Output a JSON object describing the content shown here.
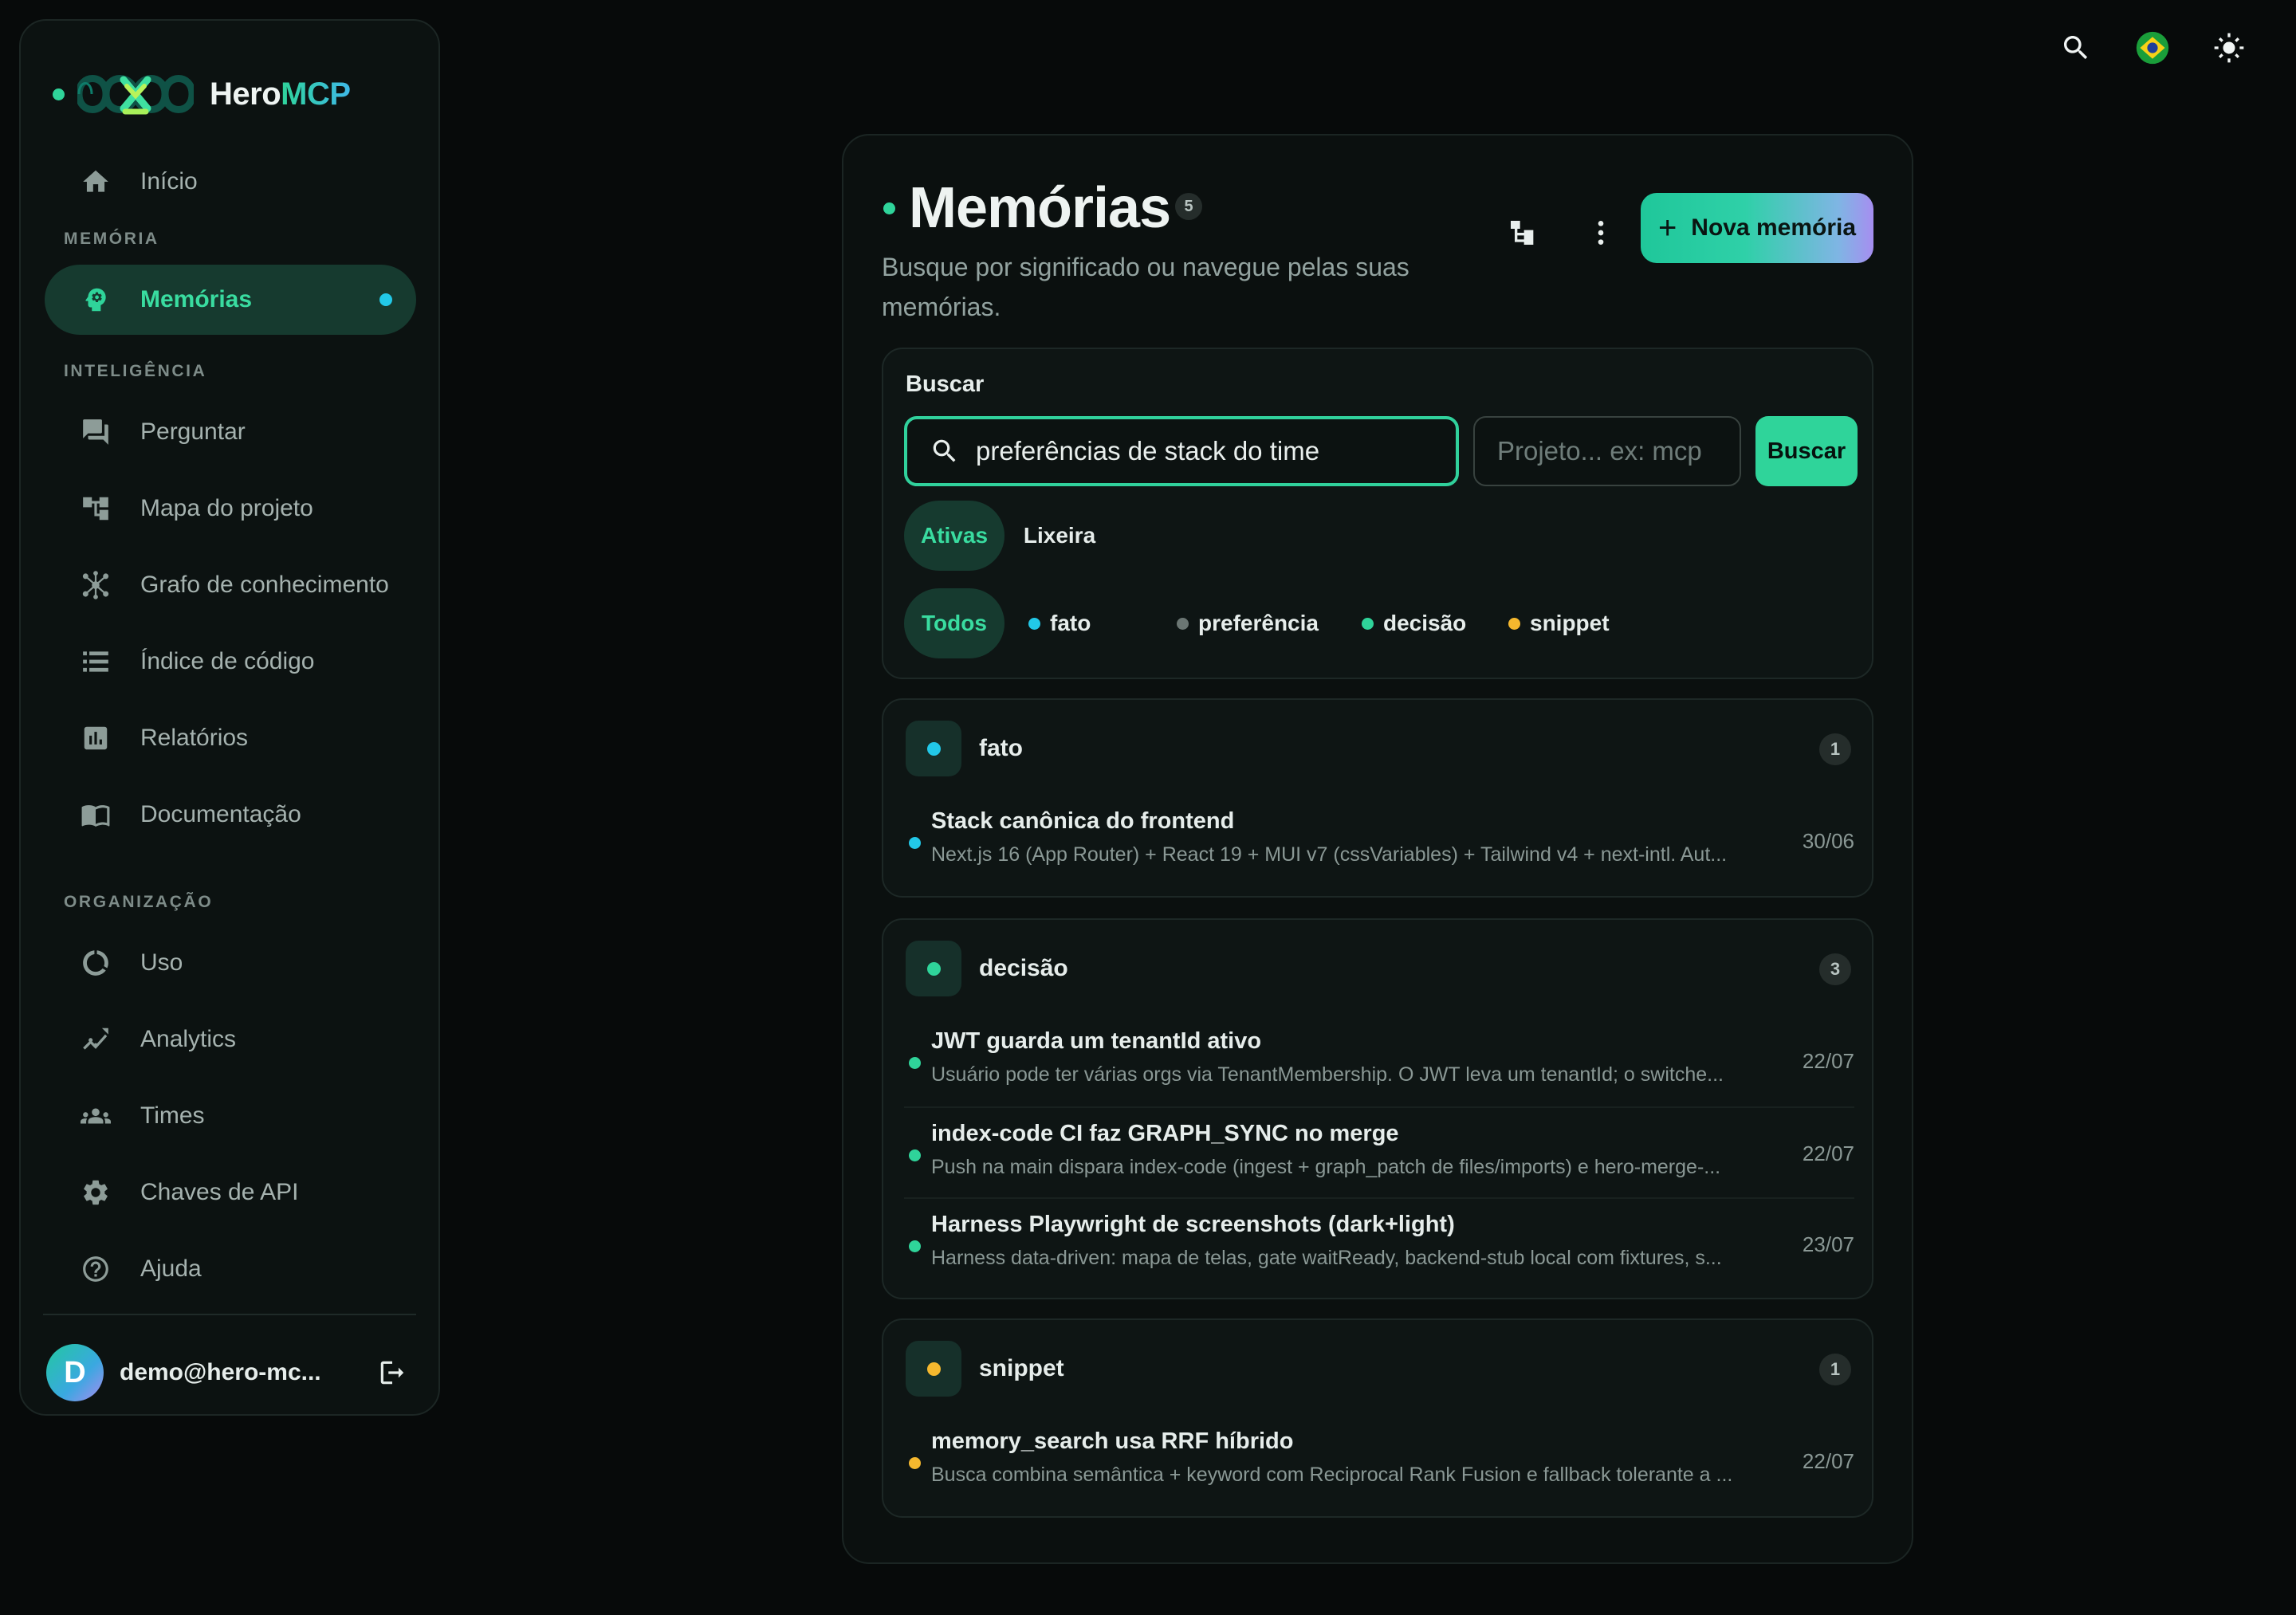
{
  "brand": {
    "name_part1": "Hero",
    "name_part2": "MCP"
  },
  "sidebar": {
    "home": {
      "label": "Início",
      "icon": "home-icon"
    },
    "section_memory": "MEMÓRIA",
    "memories": {
      "label": "Memórias",
      "icon": "brain-icon",
      "active": true
    },
    "section_intelligence": "INTELIGÊNCIA",
    "ask": {
      "label": "Perguntar",
      "icon": "chat-icon"
    },
    "project_map": {
      "label": "Mapa do projeto",
      "icon": "tree-icon"
    },
    "knowledge_graph": {
      "label": "Grafo de conhecimento",
      "icon": "graph-icon"
    },
    "code_index": {
      "label": "Índice de código",
      "icon": "list-icon"
    },
    "reports": {
      "label": "Relatórios",
      "icon": "chart-icon"
    },
    "docs": {
      "label": "Documentação",
      "icon": "book-icon"
    },
    "section_org": "ORGANIZAÇÃO",
    "usage": {
      "label": "Uso",
      "icon": "donut-icon"
    },
    "analytics": {
      "label": "Analytics",
      "icon": "trend-icon"
    },
    "teams": {
      "label": "Times",
      "icon": "people-icon"
    },
    "api_keys": {
      "label": "Chaves de API",
      "icon": "gear-icon"
    },
    "help": {
      "label": "Ajuda",
      "icon": "help-icon"
    }
  },
  "user": {
    "initial": "D",
    "email": "demo@hero-mc..."
  },
  "header": {
    "title": "Memórias",
    "count": "5",
    "subtitle": "Busque por significado ou navegue pelas suas memórias.",
    "new_button": "Nova memória",
    "new_button_plus": "+"
  },
  "search": {
    "label": "Buscar",
    "query": "preferências de stack do time",
    "project_placeholder": "Projeto... ex: mcp",
    "button": "Buscar"
  },
  "status_tabs": {
    "active": "Ativas",
    "trash": "Lixeira"
  },
  "type_filters": {
    "all": "Todos",
    "fato": {
      "label": "fato",
      "color": "#22c8e8"
    },
    "preferencia": {
      "label": "preferência",
      "color": "#6b7673"
    },
    "decisao": {
      "label": "decisão",
      "color": "#2fd49a"
    },
    "snippet": {
      "label": "snippet",
      "color": "#f5b82e"
    }
  },
  "groups": [
    {
      "name": "fato",
      "count": "1",
      "color": "#22c8e8",
      "items": [
        {
          "title": "Stack canônica do frontend",
          "desc": "Next.js 16 (App Router) + React 19 + MUI v7 (cssVariables) + Tailwind v4 + next-intl. Aut...",
          "date": "30/06"
        }
      ]
    },
    {
      "name": "decisão",
      "count": "3",
      "color": "#2fd49a",
      "items": [
        {
          "title": "JWT guarda um tenantId ativo",
          "desc": "Usuário pode ter várias orgs via TenantMembership. O JWT leva um tenantId; o switche...",
          "date": "22/07"
        },
        {
          "title": "index-code CI faz GRAPH_SYNC no merge",
          "desc": "Push na main dispara index-code (ingest + graph_patch de files/imports) e hero-merge-...",
          "date": "22/07"
        },
        {
          "title": "Harness Playwright de screenshots (dark+light)",
          "desc": "Harness data-driven: mapa de telas, gate waitReady, backend-stub local com fixtures, s...",
          "date": "23/07"
        }
      ]
    },
    {
      "name": "snippet",
      "count": "1",
      "color": "#f5b82e",
      "items": [
        {
          "title": "memory_search usa RRF híbrido",
          "desc": "Busca combina semântica + keyword com Reciprocal Rank Fusion e fallback tolerante a ...",
          "date": "22/07"
        }
      ]
    }
  ]
}
